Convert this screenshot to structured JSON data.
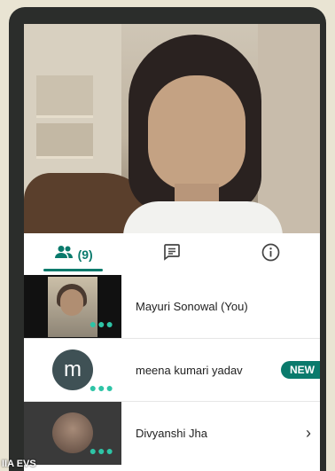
{
  "tabs": {
    "participants_count": "(9)",
    "active": "participants"
  },
  "participants": [
    {
      "name": "Mayuri Sonowal (You)",
      "thumb": "video",
      "badge": ""
    },
    {
      "name": "meena kumari yadav",
      "thumb": "avatar",
      "initial": "m",
      "badge": "NEW"
    },
    {
      "name": "Divyanshi Jha",
      "thumb": "video-dark",
      "badge": ""
    }
  ],
  "caption": "IIA EVS",
  "colors": {
    "accent": "#0a7a6c",
    "dots": "#2ec4a6",
    "avatar_bg": "#3f5155"
  },
  "icons": [
    "people-icon",
    "chat-icon",
    "info-icon",
    "more-dots-icon",
    "chevron-right-icon"
  ]
}
